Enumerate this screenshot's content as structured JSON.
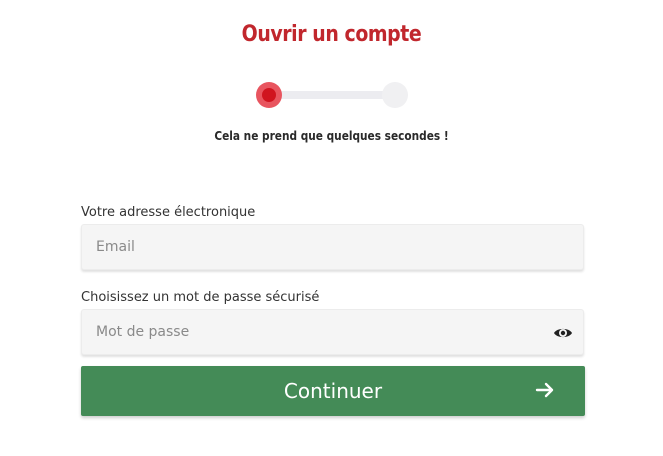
{
  "header": {
    "title": "Ouvrir un compte",
    "subtitle": "Cela ne prend que quelques secondes !"
  },
  "stepper": {
    "current_step": 1,
    "total_steps": 2
  },
  "form": {
    "email_label": "Votre adresse électronique",
    "email_placeholder": "Email",
    "email_value": "",
    "password_label": "Choisissez un mot de passe sécurisé",
    "password_placeholder": "Mot de passe",
    "password_value": "",
    "password_toggle_icon": "eye-icon",
    "continue_label": "Continuer",
    "continue_icon": "arrow-right-icon"
  },
  "colors": {
    "title": "#c1272d",
    "step_active": "#d0141f",
    "button": "#448b57"
  }
}
